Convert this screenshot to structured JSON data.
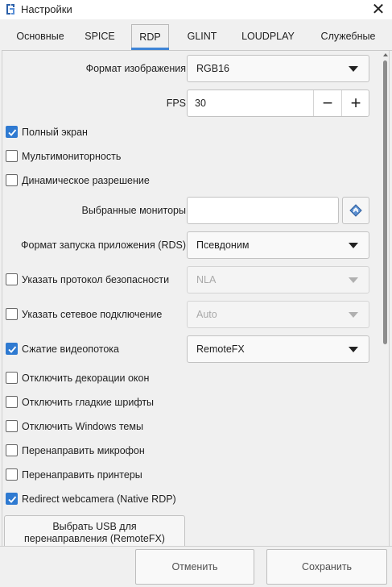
{
  "window": {
    "title": "Настройки"
  },
  "tabs": [
    {
      "label": "Основные",
      "active": false
    },
    {
      "label": "SPICE",
      "active": false
    },
    {
      "label": "RDP",
      "active": true
    },
    {
      "label": "GLINT",
      "active": false
    },
    {
      "label": "LOUDPLAY",
      "active": false
    },
    {
      "label": "Служебные",
      "active": false
    }
  ],
  "form": {
    "image_format": {
      "label": "Формат изображения",
      "value": "RGB16"
    },
    "fps": {
      "label": "FPS",
      "value": "30",
      "minus": "−",
      "plus": "+"
    },
    "fullscreen": {
      "label": "Полный экран",
      "checked": true
    },
    "multimonitor": {
      "label": "Мультимониторность",
      "checked": false
    },
    "dynamic_resolution": {
      "label": "Динамическое разрешение",
      "checked": false
    },
    "selected_monitors": {
      "label": "Выбранные мониторы",
      "value": ""
    },
    "app_launch_format": {
      "label": "Формат запуска приложения (RDS)",
      "value": "Псевдоним"
    },
    "security_protocol": {
      "label": "Указать протокол безопасности",
      "checked": false,
      "value": "NLA"
    },
    "network_connection": {
      "label": "Указать сетевое подключение",
      "checked": false,
      "value": "Auto"
    },
    "video_compression": {
      "label": "Сжатие видеопотока",
      "checked": true,
      "value": "RemoteFX"
    },
    "disable_window_decorations": {
      "label": "Отключить декорации окон",
      "checked": false
    },
    "disable_smooth_fonts": {
      "label": "Отключить гладкие шрифты",
      "checked": false
    },
    "disable_windows_themes": {
      "label": "Отключить Windows темы",
      "checked": false
    },
    "redirect_microphone": {
      "label": "Перенаправить микрофон",
      "checked": false
    },
    "redirect_printers": {
      "label": "Перенаправить принтеры",
      "checked": false
    },
    "redirect_webcamera": {
      "label": "Redirect webcamera (Native RDP)",
      "checked": true
    },
    "usb_button": {
      "line1": "Выбрать USB для",
      "line2": "перенаправления (RemoteFX)"
    }
  },
  "buttons": {
    "cancel": "Отменить",
    "save": "Сохранить"
  },
  "colors": {
    "accent": "#2f7ad1",
    "tab_underline": "#3e84d6"
  },
  "icons": {
    "app": "app-logo-icon",
    "close": "close-icon",
    "monitor_picker": "diamond-select-icon"
  }
}
